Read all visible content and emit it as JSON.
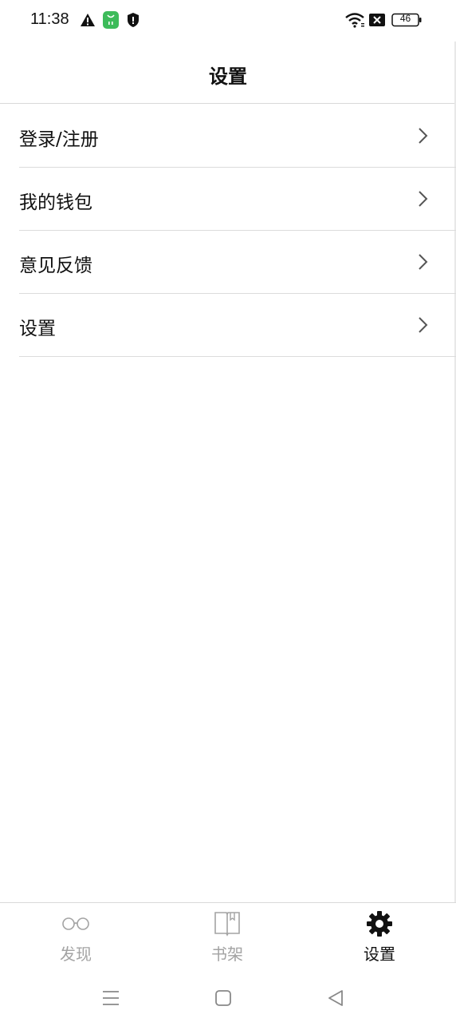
{
  "status_bar": {
    "time": "11:38",
    "battery": "46",
    "icons": [
      "alert-triangle-icon",
      "app-notification-icon",
      "shield-icon",
      "wifi-icon",
      "sim-off-icon",
      "battery-icon"
    ]
  },
  "header": {
    "title": "设置"
  },
  "menu": {
    "items": [
      {
        "label": "登录/注册",
        "icon": "chevron-right-icon"
      },
      {
        "label": "我的钱包",
        "icon": "chevron-right-icon"
      },
      {
        "label": "意见反馈",
        "icon": "chevron-right-icon"
      },
      {
        "label": "设置",
        "icon": "chevron-right-icon"
      }
    ]
  },
  "tab_bar": {
    "tabs": [
      {
        "label": "发现",
        "icon": "glasses-icon",
        "active": false
      },
      {
        "label": "书架",
        "icon": "book-icon",
        "active": false
      },
      {
        "label": "设置",
        "icon": "gear-icon",
        "active": true
      }
    ]
  },
  "colors": {
    "active": "#111111",
    "inactive": "#a3a3a3",
    "divider": "#dcdcdc",
    "app_green": "#3dbb5a"
  }
}
